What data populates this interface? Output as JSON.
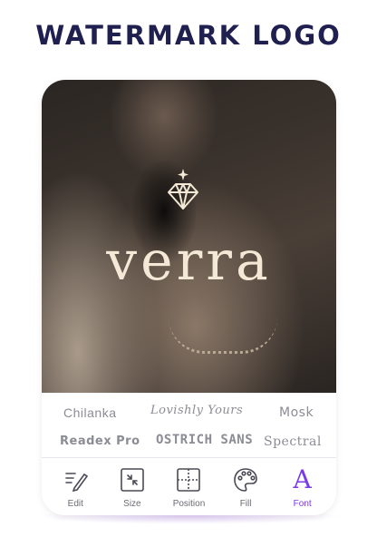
{
  "headline": "WATERMARK LOGO",
  "logo": {
    "wordmark": "verra",
    "accent_color": "#f3e9d6"
  },
  "font_options": [
    "Chilanka",
    "Lovishly Yours",
    "Mosk",
    "Readex Pro",
    "OSTRICH SANS",
    "Spectral"
  ],
  "toolbar": {
    "items": [
      {
        "label": "Edit",
        "icon": "pencil-icon"
      },
      {
        "label": "Size",
        "icon": "resize-icon"
      },
      {
        "label": "Position",
        "icon": "position-grid-icon"
      },
      {
        "label": "Fill",
        "icon": "palette-icon"
      },
      {
        "label": "Font",
        "icon": "font-a-icon",
        "active": true
      }
    ],
    "active_color": "#7a3ae8"
  },
  "colors": {
    "headline": "#1f2050",
    "accent": "#7a3ae8"
  }
}
